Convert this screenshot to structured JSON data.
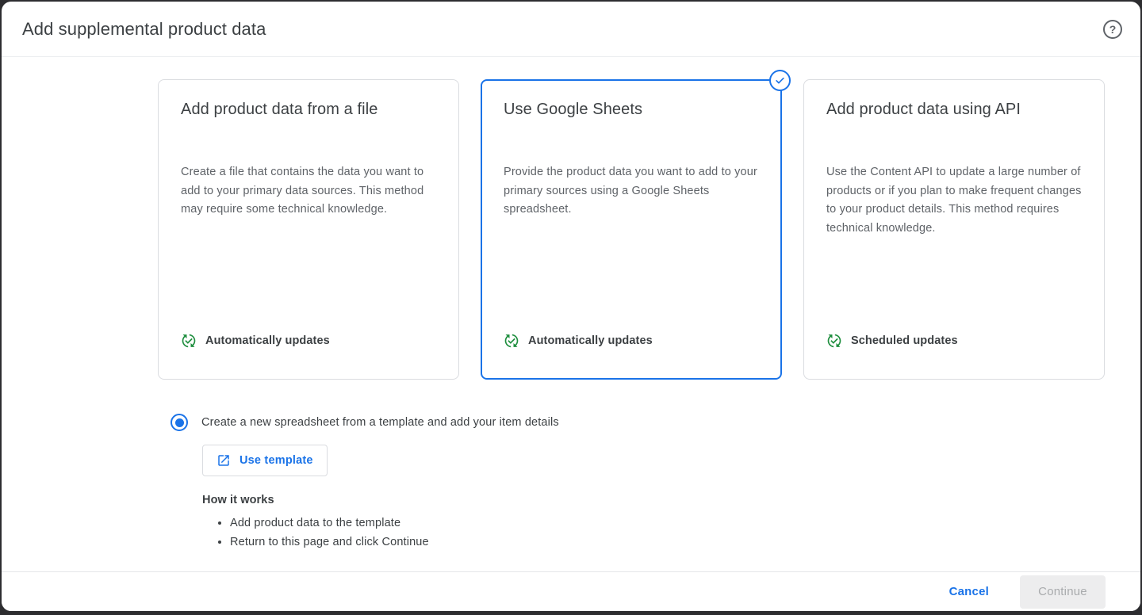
{
  "dialog": {
    "title": "Add supplemental product data"
  },
  "cards": [
    {
      "title": "Add product data from a file",
      "description": "Create a file that contains the data you want to add to your primary data sources. This method may require some technical knowledge.",
      "badge": "Automatically updates",
      "selected": false
    },
    {
      "title": "Use Google Sheets",
      "description": "Provide the product data you want to add to your primary sources using a Google Sheets spreadsheet.",
      "badge": "Automatically updates",
      "selected": true
    },
    {
      "title": "Add product data using API",
      "description": "Use the Content API to update a large number of products or if you plan to make frequent changes to your product details. This method requires technical knowledge.",
      "badge": "Scheduled updates",
      "selected": false
    }
  ],
  "options": {
    "radio_label": "Create a new spreadsheet from a template and add your item details",
    "radio_selected": true,
    "use_template_label": "Use template",
    "how_it_works_title": "How it works",
    "steps": [
      "Add product data to the template",
      "Return to this page and click Continue"
    ]
  },
  "footer": {
    "cancel_label": "Cancel",
    "continue_label": "Continue",
    "continue_disabled": true
  },
  "icons": {
    "help": "?",
    "selected_check": "check-in-circle",
    "update_badge": "sync-arrows-with-check",
    "use_template": "open-in-new"
  },
  "colors": {
    "accent_blue": "#1a73e8",
    "success_green": "#1e8e3e",
    "card_border": "#dadce0",
    "text_primary": "#3c4043",
    "text_secondary": "#5f6368"
  }
}
